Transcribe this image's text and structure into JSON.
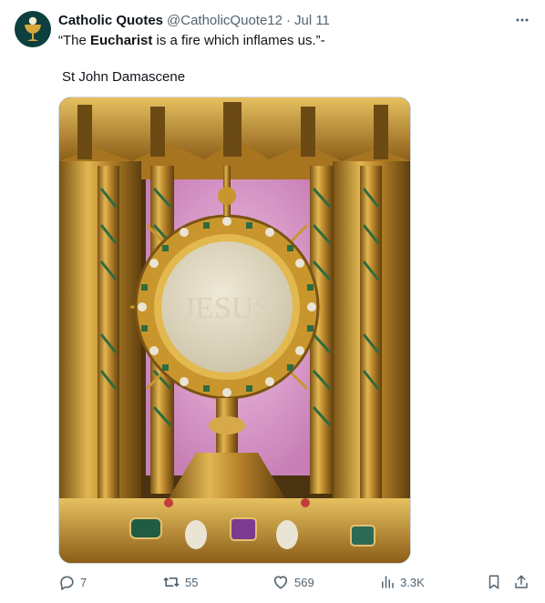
{
  "author": {
    "name": "Catholic Quotes",
    "handle": "@CatholicQuote12",
    "separator": "·",
    "date": "Jul 11"
  },
  "tweet": {
    "quote_open": "“The ",
    "quote_bold": "Eucharist",
    "quote_rest": " is a fire which inflames us.”-",
    "attribution": "St John Damascene"
  },
  "media": {
    "image_text": "JESUS",
    "colors": {
      "gold": "#c9962e",
      "pink": "#e9a6d8",
      "host": "#e3dcc7",
      "green": "#2f6b3f"
    }
  },
  "actions": {
    "replies": "7",
    "reposts": "55",
    "likes": "569",
    "views": "3.3K"
  },
  "icons": [
    "chalice-icon",
    "more-icon",
    "reply-icon",
    "repost-icon",
    "like-icon",
    "views-icon",
    "bookmark-icon",
    "share-icon"
  ],
  "colors": {
    "text": "#0f1419",
    "secondary": "#536471",
    "border": "#cfd9de",
    "avatar_bg": "#0c3f3d"
  }
}
